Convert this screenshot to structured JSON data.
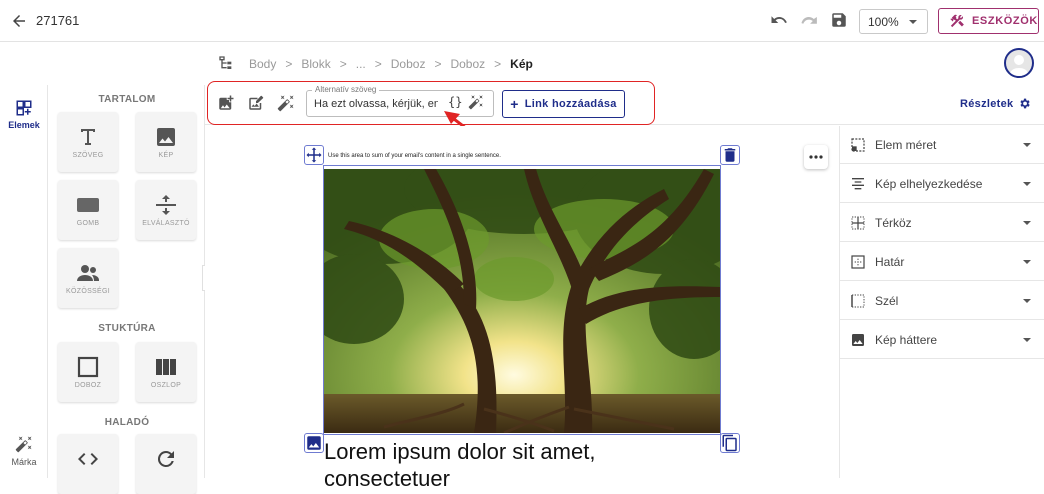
{
  "header": {
    "doc_id": "271761",
    "zoom": "100%",
    "tools_label": "ESZKÖZÖK"
  },
  "rail": {
    "elements_label": "Elemek",
    "brand_label": "Márka"
  },
  "blocks": {
    "section_content": "TARTALOM",
    "section_structure": "STUKTÚRA",
    "section_advanced": "HALADÓ",
    "text": "SZÖVEG",
    "image": "KÉP",
    "button": "GOMB",
    "divider": "ELVÁLASZTÓ",
    "social": "KÖZÖSSÉGI",
    "box": "DOBOZ",
    "column": "OSZLOP"
  },
  "breadcrumb": {
    "items": [
      "Body",
      ">",
      "Blokk",
      ">",
      "...",
      ">",
      "Doboz",
      ">",
      "Doboz",
      ">"
    ],
    "current": "Kép"
  },
  "toolbar": {
    "alt_legend": "Alternatív szöveg",
    "alt_value": "Ha ezt olvassa, kérjük, engedélyezze a képeket",
    "braces": "{}",
    "link_label": "Link hozzáadása",
    "details_label": "Részletek"
  },
  "canvas": {
    "top_text": "Use this area to sum of your email's content in a single sentence.",
    "body_text": "Lorem ipsum dolor sit amet, consectetuer"
  },
  "properties": {
    "items": [
      "Elem méret",
      "Kép elhelyezkedése",
      "Térköz",
      "Határ",
      "Szél",
      "Kép háttere"
    ]
  },
  "colors": {
    "brand_blue": "#1f2d8a",
    "tools_magenta": "#a0306e",
    "highlight_red": "#e02424",
    "selection_blue": "#6f7bd1"
  }
}
